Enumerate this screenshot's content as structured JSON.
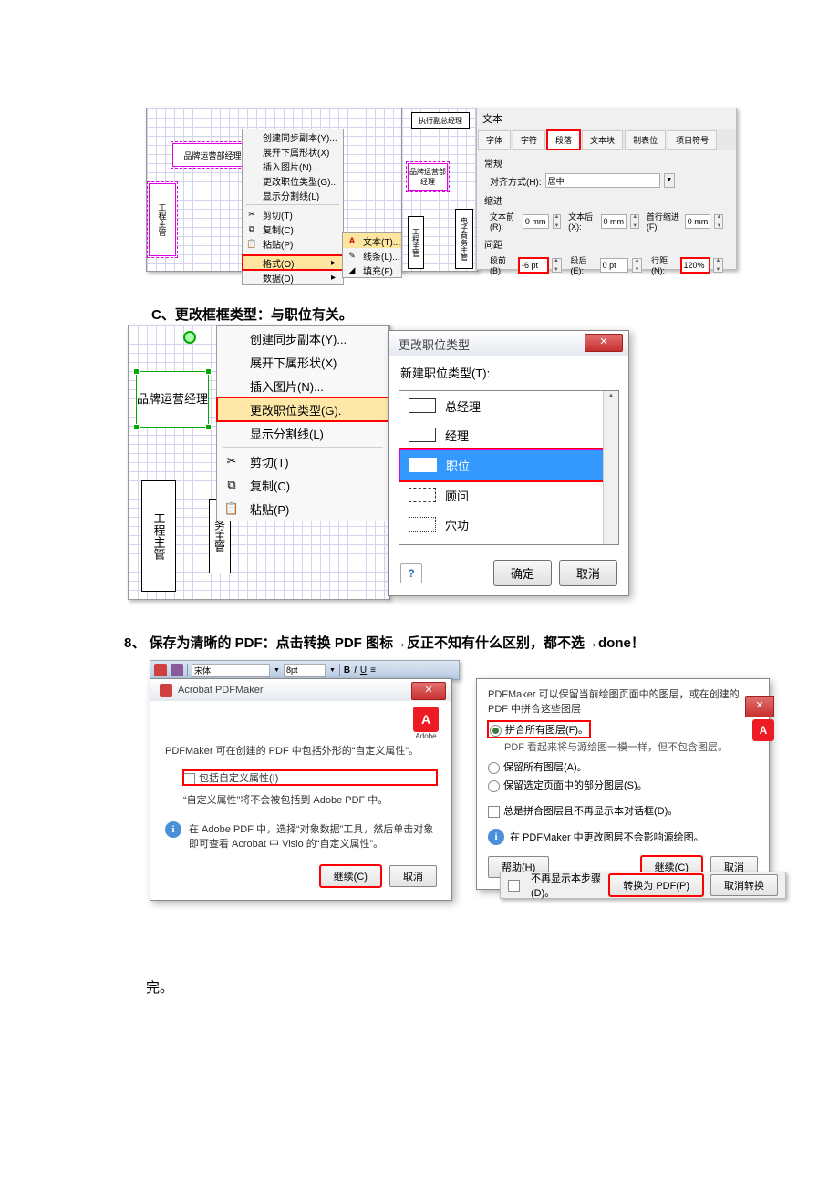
{
  "txt_c": "C、更改框框类型：与职位有关。",
  "txt_8": "8、 保存为清晰的 PDF：点击转换 PDF 图标→反正不知有什么区别，都不选→done！",
  "txt_end": "完。",
  "fig1": {
    "box1": "品牌运营部经理",
    "box2": "工程主管",
    "menu": {
      "m1": "创建同步副本(Y)...",
      "m2": "展开下属形状(X)",
      "m3": "插入图片(N)...",
      "m4": "更改职位类型(G)...",
      "m5": "显示分割线(L)",
      "m6": "剪切(T)",
      "m7": "复制(C)",
      "m8": "粘贴(P)",
      "m9": "格式(O)",
      "m10": "数据(D)"
    },
    "sub": {
      "s1": "文本(T)...",
      "s2": "线条(L)...",
      "s3": "填充(F)..."
    }
  },
  "fig2": {
    "top": "执行副总经理",
    "b1": "品牌运营部经理",
    "b2": "工程主管",
    "b3": "电子商务主管",
    "title": "文本",
    "tabs": {
      "t1": "字体",
      "t2": "字符",
      "t3": "段落",
      "t4": "文本块",
      "t5": "制表位",
      "t6": "项目符号"
    },
    "sec1": "常规",
    "align_l": "对齐方式(H):",
    "align_v": "居中",
    "sec2": "缩进",
    "before_l": "文本前(R):",
    "before_v": "0 mm",
    "after_l": "文本后(X):",
    "after_v": "0 mm",
    "first_l": "首行缩进(F):",
    "first_v": "0 mm",
    "sec3": "间距",
    "sb_l": "段前(B):",
    "sb_v": "-6 pt",
    "sa_l": "段后(E):",
    "sa_v": "0 pt",
    "ls_l": "行距(N):",
    "ls_v": "120%"
  },
  "fig3": {
    "box1": "品牌运营经理",
    "box2": "工程主管",
    "box3": "务主管",
    "menu": {
      "m1": "创建同步副本(Y)...",
      "m2": "展开下属形状(X)",
      "m3": "插入图片(N)...",
      "m4": "更改职位类型(G).",
      "m5": "显示分割线(L)",
      "m6": "剪切(T)",
      "m7": "复制(C)",
      "m8": "粘贴(P)"
    },
    "dlg": {
      "title": "更改职位类型",
      "label": "新建职位类型(T):",
      "i1": "总经理",
      "i2": "经理",
      "i3": "职位",
      "i4": "顾问",
      "i5": "穴功",
      "ok": "确定",
      "cancel": "取消"
    }
  },
  "toolbar": {
    "font": "宋体",
    "size": "8pt"
  },
  "pdf1": {
    "title": "Acrobat PDFMaker",
    "line1": "PDFMaker 可在创建的 PDF 中包括外形的“自定义属性”。",
    "chk": "包括自定义属性(I)",
    "line2": "“自定义属性”将不会被包括到 Adobe PDF 中。",
    "info": "在 Adobe PDF 中，选择“对象数据”工具，然后单击对象即可查看 Acrobat 中 Visio 的“自定义属性”。",
    "cont": "继续(C)",
    "cancel": "取消",
    "brand": "Adobe"
  },
  "pdf2": {
    "line1": "PDFMaker 可以保留当前绘图页面中的图层，或在创建的 PDF 中拼合这些图层",
    "r1": "拼合所有图层(F)。",
    "r1b": "PDF 看起来将与源绘图一模一样，但不包含图层。",
    "r2": "保留所有图层(A)。",
    "r3": "保留选定页面中的部分图层(S)。",
    "chk": "总是拼合图层且不再显示本对话框(D)。",
    "info": "在 PDFMaker 中更改图层不会影响源绘图。",
    "help": "帮助(H)",
    "cont": "继续(C)",
    "cancel": "取消",
    "chk2": "不再显示本步骤(D)。",
    "conv": "转换为 PDF(P)",
    "cancel2": "取消转换"
  }
}
